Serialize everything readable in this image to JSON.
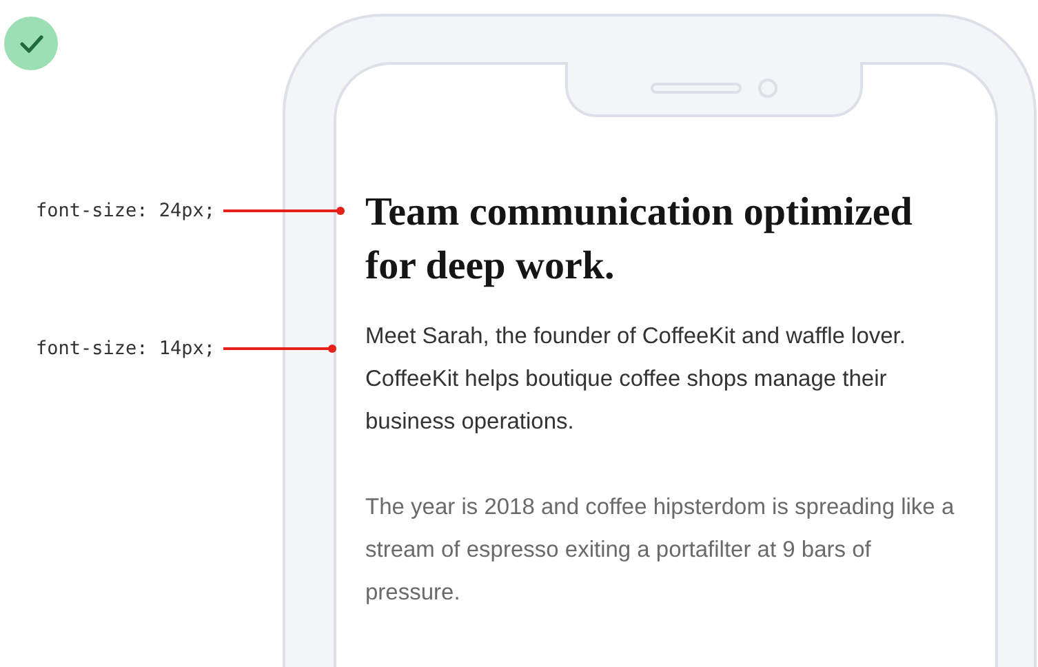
{
  "badge": {
    "kind": "check"
  },
  "annotations": [
    {
      "label": "font-size: 24px;"
    },
    {
      "label": "font-size: 14px;"
    }
  ],
  "phone": {
    "heading": "Team communication optimized for deep work.",
    "paragraphs": [
      "Meet Sarah, the founder of CoffeeKit and waffle lover. CoffeeKit helps boutique coffee shops manage their business operations.",
      "The year is 2018 and coffee hipsterdom is spreading like a stream of espresso exiting a portafilter at 9 bars of pressure."
    ]
  }
}
